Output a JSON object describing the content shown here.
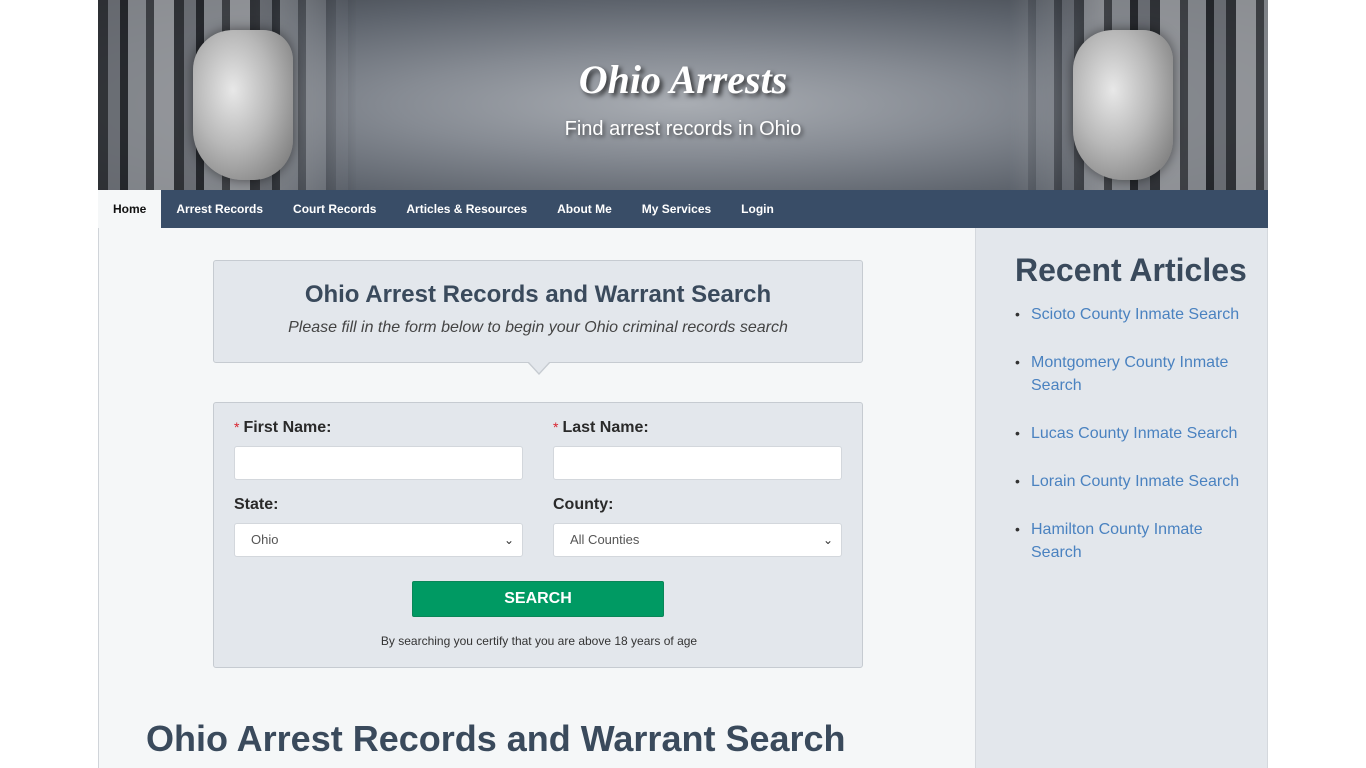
{
  "header": {
    "title": "Ohio Arrests",
    "tagline": "Find arrest records in Ohio"
  },
  "nav": {
    "items": [
      {
        "label": "Home",
        "active": true
      },
      {
        "label": "Arrest Records"
      },
      {
        "label": "Court Records"
      },
      {
        "label": "Articles & Resources"
      },
      {
        "label": "About Me"
      },
      {
        "label": "My Services"
      },
      {
        "label": "Login"
      }
    ]
  },
  "search_panel": {
    "title": "Ohio Arrest Records and Warrant Search",
    "subtitle": "Please fill in the form below to begin your Ohio criminal records search"
  },
  "form": {
    "required_marker": "*",
    "first_name": {
      "label": "First Name:",
      "value": "",
      "placeholder": ""
    },
    "last_name": {
      "label": "Last Name:",
      "value": "",
      "placeholder": ""
    },
    "state": {
      "label": "State:",
      "selected": "Ohio"
    },
    "county": {
      "label": "County:",
      "selected": "All Counties"
    },
    "submit_label": "SEARCH",
    "disclaimer": "By searching you certify that you are above 18 years of age"
  },
  "main": {
    "heading": "Ohio Arrest Records and Warrant Search"
  },
  "sidebar": {
    "title": "Recent Articles",
    "articles": [
      {
        "label": "Scioto County Inmate Search"
      },
      {
        "label": "Montgomery County Inmate Search"
      },
      {
        "label": "Lucas County Inmate Search"
      },
      {
        "label": "Lorain County Inmate Search"
      },
      {
        "label": "Hamilton County Inmate Search"
      }
    ]
  },
  "colors": {
    "nav_bg": "#1e3452",
    "button_green": "#009a63",
    "link_blue": "#4a82c0",
    "heading_slate": "#3a4a5c",
    "required_red": "#d9232e"
  }
}
